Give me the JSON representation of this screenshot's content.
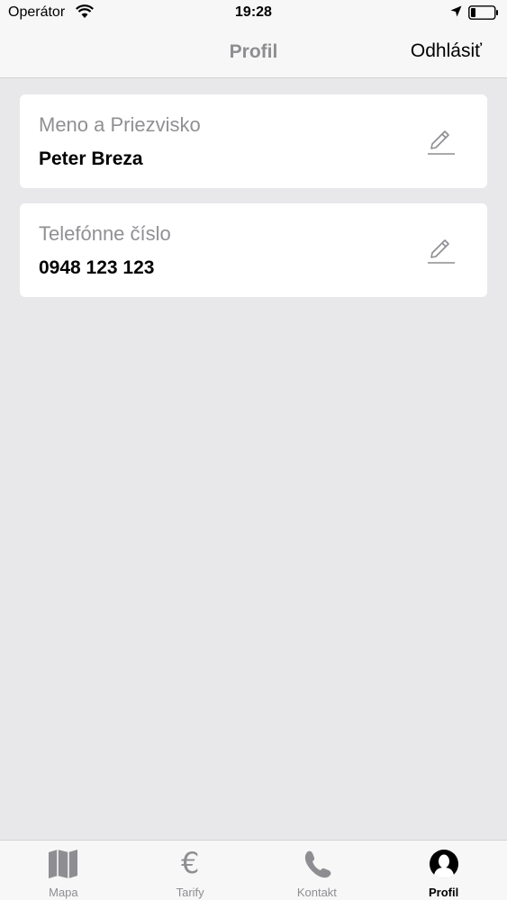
{
  "status_bar": {
    "carrier": "Operátor",
    "time": "19:28",
    "icons": [
      "wifi-icon",
      "location-icon",
      "battery-icon"
    ]
  },
  "nav": {
    "title": "Profil",
    "logout_label": "Odhlásiť"
  },
  "profile": {
    "name_label": "Meno a Priezvisko",
    "name_value": "Peter Breza",
    "phone_label": "Telefónne číslo",
    "phone_value": "0948 123 123"
  },
  "tabs": [
    {
      "label": "Mapa",
      "icon": "map-icon",
      "active": false
    },
    {
      "label": "Tarify",
      "icon": "euro-icon",
      "glyph": "€",
      "active": false
    },
    {
      "label": "Kontakt",
      "icon": "phone-icon",
      "active": false
    },
    {
      "label": "Profil",
      "icon": "profile-icon",
      "active": true
    }
  ],
  "colors": {
    "background": "#e8e7ea",
    "bar": "#f7f7f7",
    "muted": "#8e8e92",
    "card": "#ffffff"
  }
}
